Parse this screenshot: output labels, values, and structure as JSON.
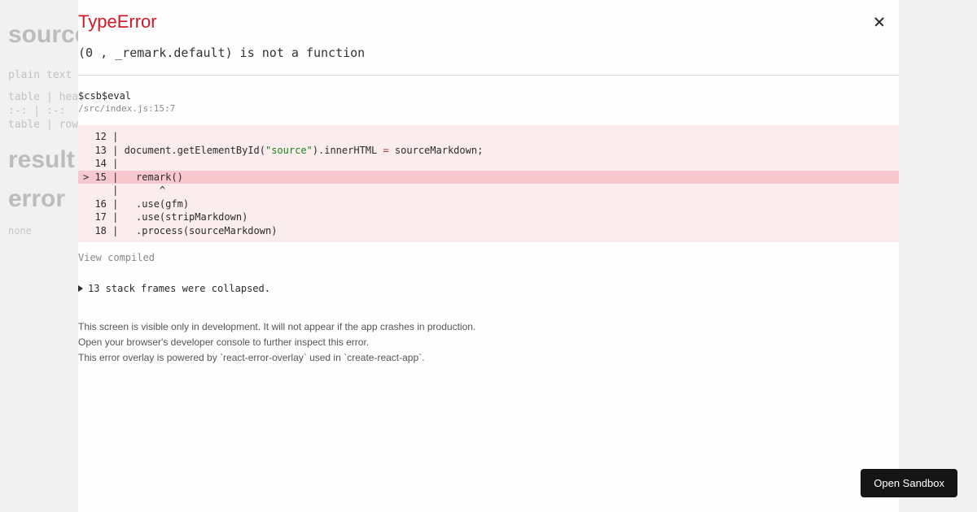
{
  "background": {
    "heading_source": "source",
    "subheading": "plain text",
    "line1": "table | hea",
    "line2": ":-: | :-:",
    "line3": "table | row",
    "heading_result": "result",
    "heading_error": "error",
    "error_value": "none"
  },
  "overlay": {
    "title": "TypeError",
    "message": "(0 , _remark.default) is not a function",
    "frame_name": "$csb$eval",
    "frame_location": "/src/index.js:15:7",
    "code": {
      "l12": "  12 | ",
      "l13_a": "  13 | document.getElementById(",
      "l13_str": "\"source\"",
      "l13_b": ").innerHTML ",
      "l13_op": "=",
      "l13_c": " sourceMarkdown;",
      "l14": "  14 | ",
      "l15": "> 15 |   remark()",
      "l15_caret": "     |       ^",
      "l16": "  16 |   .use(gfm)",
      "l17": "  17 |   .use(stripMarkdown)",
      "l18": "  18 |   .process(sourceMarkdown)"
    },
    "view_compiled": "View compiled",
    "collapsed_frames": "13 stack frames were collapsed.",
    "footer_line1": "This screen is visible only in development. It will not appear if the app crashes in production.",
    "footer_line2": "Open your browser's developer console to further inspect this error.",
    "footer_line3": "This error overlay is powered by `react-error-overlay` used in `create-react-app`."
  },
  "button": {
    "open_sandbox": "Open Sandbox"
  }
}
